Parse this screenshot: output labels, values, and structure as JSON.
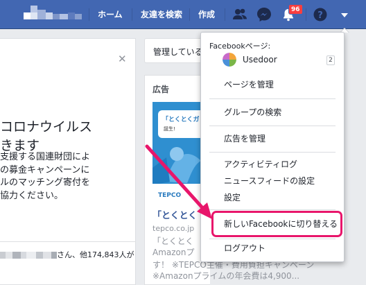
{
  "topbar": {
    "home_label": "ホーム",
    "find_friends_label": "友達を検索",
    "create_label": "作成",
    "notification_count": "96"
  },
  "left_card": {
    "title": "コロナウイルス\nきます",
    "body": "支援する国連財団によ\nの募金キャンペーンに\nルのマッチング寄付を\n協力ください。",
    "friends_suffix": "さん、他174,843人が"
  },
  "pages_card": {
    "label": "管理している"
  },
  "ad": {
    "heading": "広告",
    "image_bubble": "「とくとくガ",
    "image_bubble_sub": "誕生!",
    "image_logo": "TEPCO",
    "title": "「とくとく",
    "domain": "tepco.co.jp",
    "lines": [
      "「とくとく",
      "Amazonプ",
      "す！ ※TEPCO主催・費用負担キャンペーン",
      "※Amazonプライムの年会費は4,900..."
    ]
  },
  "dropdown": {
    "section_label": "Facebookページ:",
    "page_name": "Usedoor",
    "page_count": "2",
    "items": {
      "manage_pages": "ページを管理",
      "find_groups": "グループの検索",
      "manage_ads": "広告を管理",
      "activity_log": "アクティビティログ",
      "news_feed_settings": "ニュースフィードの設定",
      "settings": "設定",
      "switch_new_facebook": "新しいFacebookに切り替える",
      "logout": "ログアウト"
    }
  },
  "colors": {
    "brand": "#4267b2",
    "highlight": "#e8166b",
    "badge": "#fa3e3e"
  }
}
